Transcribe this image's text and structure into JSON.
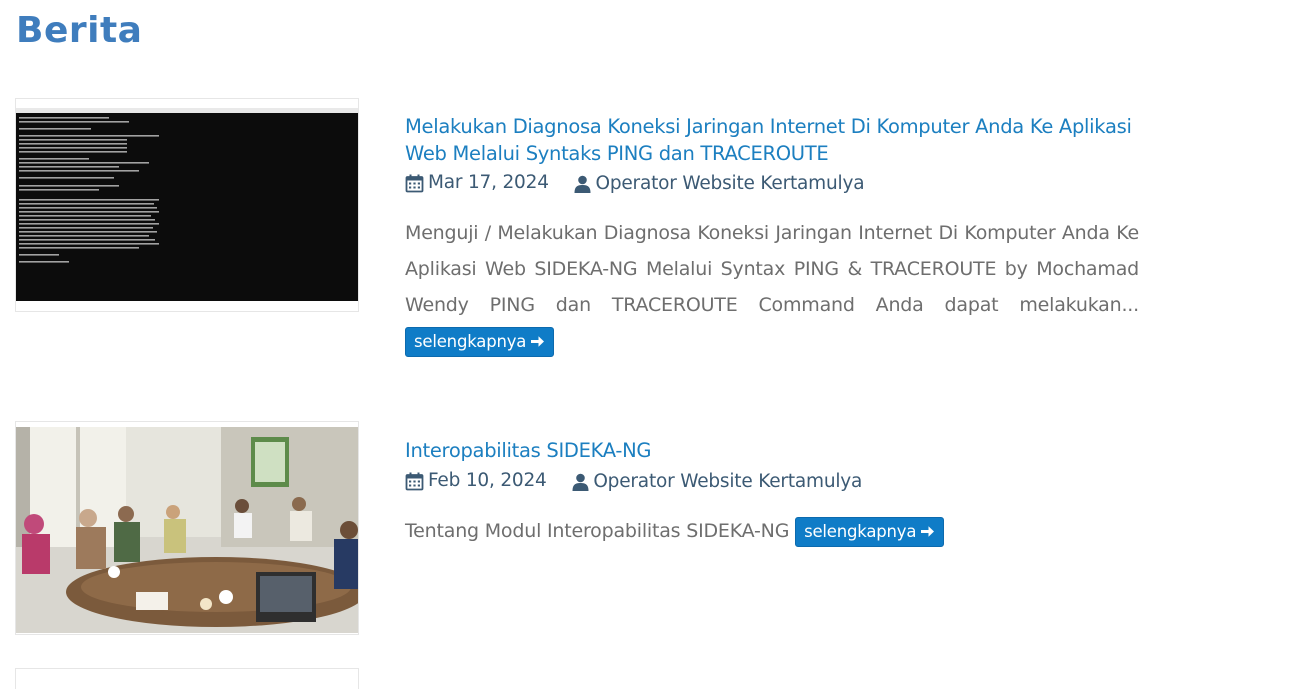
{
  "page": {
    "title": "Berita"
  },
  "articles": [
    {
      "title": "Melakukan Diagnosa Koneksi Jaringan Internet Di Komputer Anda Ke Aplikasi Web Melalui Syntaks PING dan TRACEROUTE",
      "date": "Mar 17, 2024",
      "author": "Operator Website Kertamulya",
      "excerpt": "Menguji / Melakukan Diagnosa Koneksi Jaringan Internet Di Komputer Anda Ke Aplikasi Web SIDEKA-NG Melalui Syntax PING & TRACEROUTE by Mochamad Wendy   PING dan TRACEROUTE Command Anda dapat melakukan...",
      "more_label": "selengkapnya",
      "thumbnail": "command-prompt-screenshot"
    },
    {
      "title": "Interopabilitas SIDEKA-NG",
      "date": "Feb 10, 2024",
      "author": "Operator Website Kertamulya",
      "excerpt": "Tentang Modul Interopabilitas SIDEKA-NG",
      "more_label": "selengkapnya",
      "thumbnail": "meeting-room-photo"
    }
  ],
  "colors": {
    "title": "#3f7dbd",
    "link": "#1c7fc0",
    "meta": "#3c5a74",
    "button": "#0f7cc7"
  },
  "icons": [
    "calendar-icon",
    "user-icon",
    "arrow-right-icon"
  ]
}
